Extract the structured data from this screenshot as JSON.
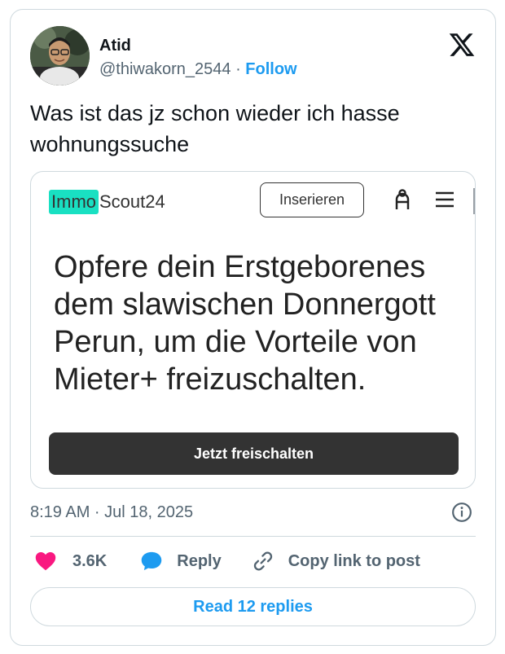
{
  "author": {
    "name": "Atid",
    "handle": "@thiwakorn_2544",
    "separator": " · ",
    "follow_label": "Follow"
  },
  "tweet": {
    "text": "Was ist das jz schon wieder ich hasse wohnungssuche",
    "timestamp": "8:19 AM · Jul 18, 2025"
  },
  "media": {
    "logo_part1": "Immo",
    "logo_part2": "Scout24",
    "insert_button": "Inserieren",
    "headline": "Opfere dein Erstgeborenes dem slawischen Donnergott Perun, um die Vorteile von Mieter+ freizuschalten.",
    "cta_label": "Jetzt freischalten",
    "accent_color": "#19e0c2",
    "icons": [
      "user-icon",
      "hamburger-menu-icon"
    ]
  },
  "actions": {
    "likes": "3.6K",
    "reply_label": "Reply",
    "copy_label": "Copy link to post"
  },
  "read_replies_label": "Read 12 replies",
  "colors": {
    "link": "#1d9bf0",
    "like": "#f91880",
    "text_secondary": "#536471",
    "border": "#cfd9de"
  }
}
